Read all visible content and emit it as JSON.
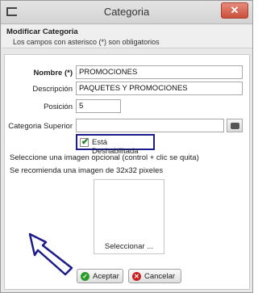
{
  "window": {
    "title": "Categoria",
    "close_glyph": "✕"
  },
  "header": {
    "title": "Modificar Categoria",
    "subtitle": "Los campos con asterisco (*) son obligatorios"
  },
  "form": {
    "nombre": {
      "label": "Nombre (*)",
      "value": "PROMOCIONES"
    },
    "descripcion": {
      "label": "Descripción",
      "value": "PAQUETES Y PROMOCIONES"
    },
    "posicion": {
      "label": "Posición",
      "value": "5"
    },
    "categoria_superior": {
      "label": "Categoria Superior",
      "value": ""
    },
    "deshabilitada": {
      "label": "Está Deshabilitada",
      "checked": true
    },
    "hint_1": "Seleccione una imagen opcional (control + clic se quita)",
    "hint_2": "Se recomienda una imagen de 32x32 pixeles",
    "image_button": "Seleccionar ..."
  },
  "buttons": {
    "accept": "Aceptar",
    "cancel": "Cancelar"
  },
  "icons": {
    "app": "window-icon",
    "lookup": "binoculars-icon",
    "accept": "check-circle-icon",
    "cancel": "x-circle-icon",
    "annotation": "arrow-pointer-icon"
  },
  "colors": {
    "close_button": "#c9503b",
    "highlight_border": "#1b1b8a",
    "accept": "#2a9a2a",
    "cancel": "#c82020"
  }
}
